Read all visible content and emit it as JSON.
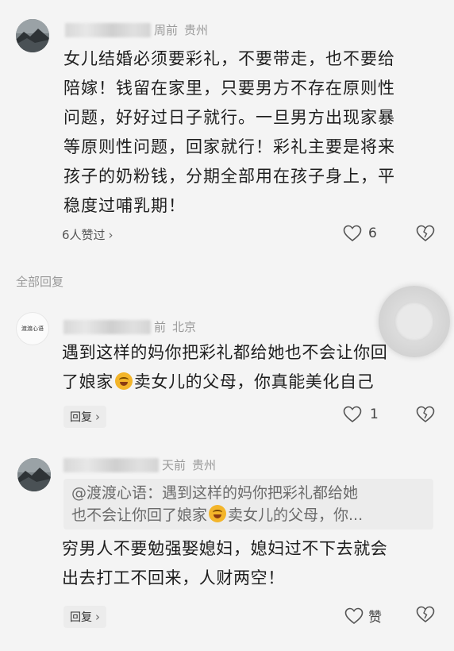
{
  "comments": [
    {
      "meta_suffix": "周前",
      "location": "贵州",
      "lines": [
        "女儿结婚必须要彩礼，不要带走，也不要给",
        "陪嫁！钱留在家里，只要男方不存在原则性",
        "问题，好好过日子就行。一旦男方出现家暴",
        "等原则性问题，回家就行！彩礼主要是将来",
        "孩子的奶粉钱，分期全部用在孩子身上，平",
        "稳度过哺乳期！"
      ],
      "likes_text": "6人赞过",
      "like_count": "6"
    },
    {
      "avatar_text": "渡渡心语",
      "meta_suffix": "前",
      "location": "北京",
      "line1": "遇到这样的妈你把彩礼都给她也不会让你回",
      "line2_a": "了娘家",
      "line2_b": "卖女儿的父母，你真能美化自己",
      "reply_label": "回复",
      "like_count": "1"
    },
    {
      "meta_suffix": "天前",
      "location": "贵州",
      "quote_line1": "@渡渡心语：遇到这样的妈你把彩礼都给她",
      "quote_line2_a": "也不会让你回了娘家",
      "quote_line2_b": "卖女儿的父母，你...",
      "lines": [
        "穷男人不要勉强娶媳妇，媳妇过不下去就会",
        "出去打工不回来，人财两空！"
      ],
      "reply_label": "回复",
      "like_label": "赞"
    }
  ],
  "section_label": "全部回复",
  "icons": {
    "heart": "heart-outline-icon",
    "dislike": "broken-heart-icon",
    "chevron": "chevron-right-icon"
  }
}
